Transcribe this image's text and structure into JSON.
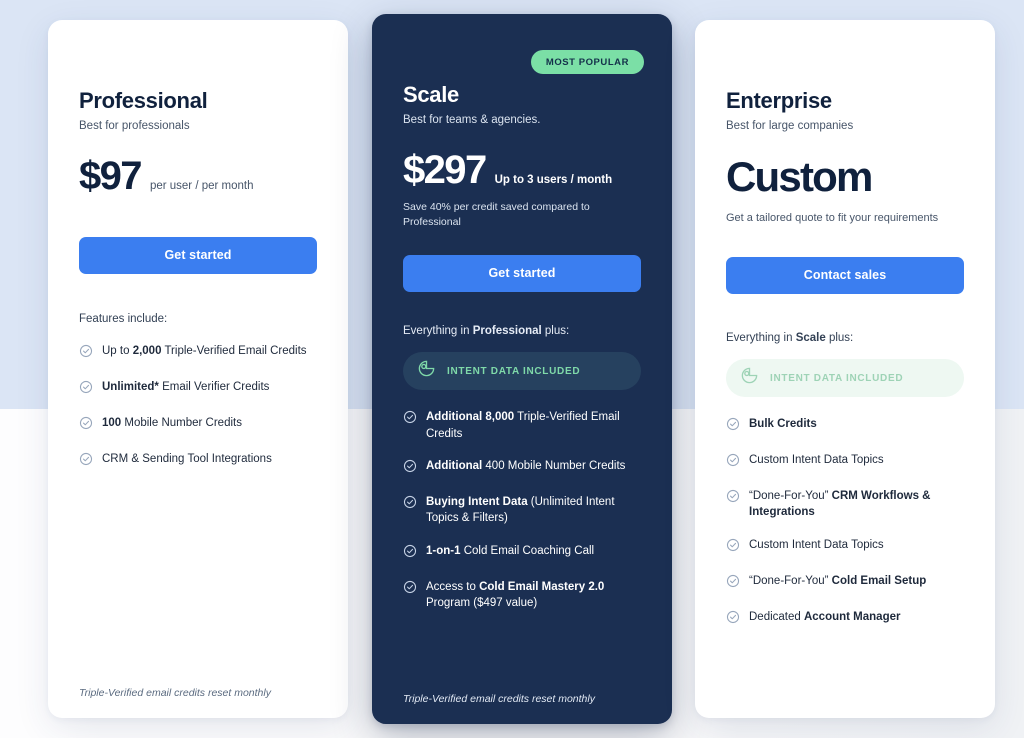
{
  "theme": {
    "accent_blue": "#3b7ef0",
    "dark_navy": "#1b2f52",
    "mint_green": "#7bdfa6",
    "page_bg_top": "#dbe5f5",
    "page_bg_bottom": "#f2f3f5"
  },
  "plans": [
    {
      "id": "professional",
      "name": "Professional",
      "tagline": "Best for professionals",
      "price": "$97",
      "price_unit": "per user / per month",
      "cta_label": "Get started",
      "features_heading": "Features include:",
      "features": [
        {
          "lead": "Up to ",
          "bold": "2,000",
          "tail": " Triple-Verified Email Credits",
          "two_line": true
        },
        {
          "lead": "",
          "bold": "Unlimited*",
          "tail": " Email Verifier Credits",
          "two_line": false
        },
        {
          "lead": "",
          "bold": "100",
          "tail": " Mobile Number Credits",
          "two_line": false
        },
        {
          "lead": "CRM & Sending Tool Integrations",
          "bold": "",
          "tail": "",
          "two_line": false
        }
      ],
      "footnote": "Triple-Verified email credits reset monthly"
    },
    {
      "id": "scale",
      "name": "Scale",
      "badge": "MOST POPULAR",
      "tagline": "Best for teams & agencies.",
      "price": "$297",
      "price_unit": "Up to 3 users / month",
      "price_note": "Save 40% per credit saved compared to Professional",
      "cta_label": "Get started",
      "features_heading_lead": "Everything in ",
      "features_heading_bold": "Professional",
      "features_heading_tail": " plus:",
      "intent_badge": "INTENT DATA INCLUDED",
      "features": [
        {
          "lead": "",
          "bold": "Additional 8,000",
          "tail": " Triple-Verified Email Credits",
          "two_line": true
        },
        {
          "lead": "",
          "bold": "Additional",
          "tail": " 400 Mobile Number Credits",
          "two_line": true
        },
        {
          "lead": "",
          "bold": "Buying Intent Data",
          "tail": " (Unlimited Intent Topics & Filters)",
          "two_line": true
        },
        {
          "lead": "",
          "bold": "1-on-1",
          "tail": " Cold Email Coaching Call",
          "two_line": false
        },
        {
          "lead": "Access to ",
          "bold": "Cold Email Mastery 2.0",
          "tail": " Program ($497 value)",
          "two_line": true
        }
      ],
      "footnote": "Triple-Verified email credits reset monthly"
    },
    {
      "id": "enterprise",
      "name": "Enterprise",
      "tagline": "Best for large companies",
      "price": "Custom",
      "custom_note": "Get a tailored quote to fit your requirements",
      "cta_label": "Contact sales",
      "features_heading_lead": "Everything in ",
      "features_heading_bold": "Scale",
      "features_heading_tail": " plus:",
      "intent_badge": "INTENT DATA INCLUDED",
      "features": [
        {
          "lead": "",
          "bold": "Bulk Credits",
          "tail": "",
          "two_line": false
        },
        {
          "lead": "Custom Intent Data Topics",
          "bold": "",
          "tail": "",
          "two_line": false
        },
        {
          "lead": "“Done-For-You” ",
          "bold": "CRM Workflows & Integrations",
          "tail": "",
          "two_line": true
        },
        {
          "lead": "Custom Intent Data Topics",
          "bold": "",
          "tail": "",
          "two_line": false
        },
        {
          "lead": "“Done-For-You” ",
          "bold": "Cold Email Setup",
          "tail": "",
          "two_line": false
        },
        {
          "lead": "Dedicated ",
          "bold": "Account Manager",
          "tail": "",
          "two_line": false
        }
      ]
    }
  ],
  "icons": {
    "check": "check-circle-icon",
    "intent": "donut-chart-icon"
  }
}
